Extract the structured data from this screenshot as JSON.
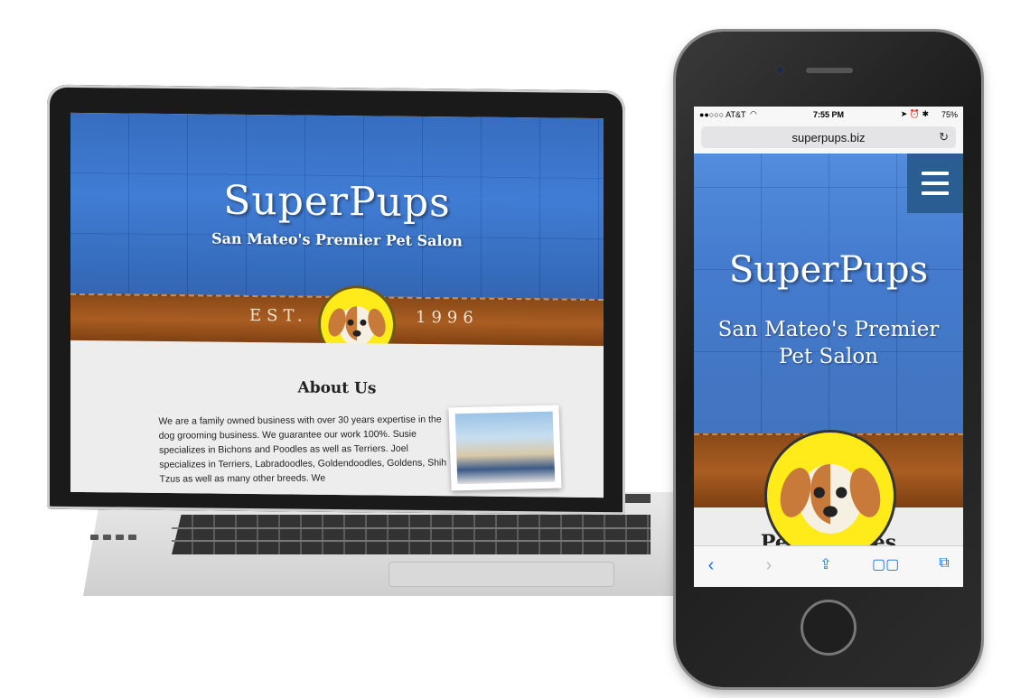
{
  "laptop_site": {
    "brand": "SuperPups",
    "tagline": "San Mateo's Premier Pet Salon",
    "est_label": "EST.",
    "est_year": "1996",
    "about_title": "About Us",
    "about_text": "We are a family owned business with over 30 years expertise in the dog grooming business. We guarantee our work 100%. Susie specializes in Bichons and Poodles as well as Terriers. Joel specializes in Terriers, Labradoodles, Goldendoodles, Goldens, Shih Tzus as well as many other breeds. We"
  },
  "phone": {
    "status": {
      "carrier": "●●○○○ AT&T",
      "wifi": "wifi-icon",
      "time": "7:55 PM",
      "right": "75%"
    },
    "url": "superpups.biz",
    "brand": "SuperPups",
    "tagline_line1": "San Mateo's Premier",
    "tagline_line2": "Pet Salon",
    "cut_heading": "Pet Services",
    "toolbar_icons": [
      "back-icon",
      "forward-icon",
      "share-icon",
      "bookmarks-icon",
      "tabs-icon"
    ]
  },
  "colors": {
    "hero_blue": "#2a6ed0",
    "leather": "#a95d22",
    "logo_yellow": "#ffeb1a",
    "safari_blue": "#1a73e8"
  }
}
